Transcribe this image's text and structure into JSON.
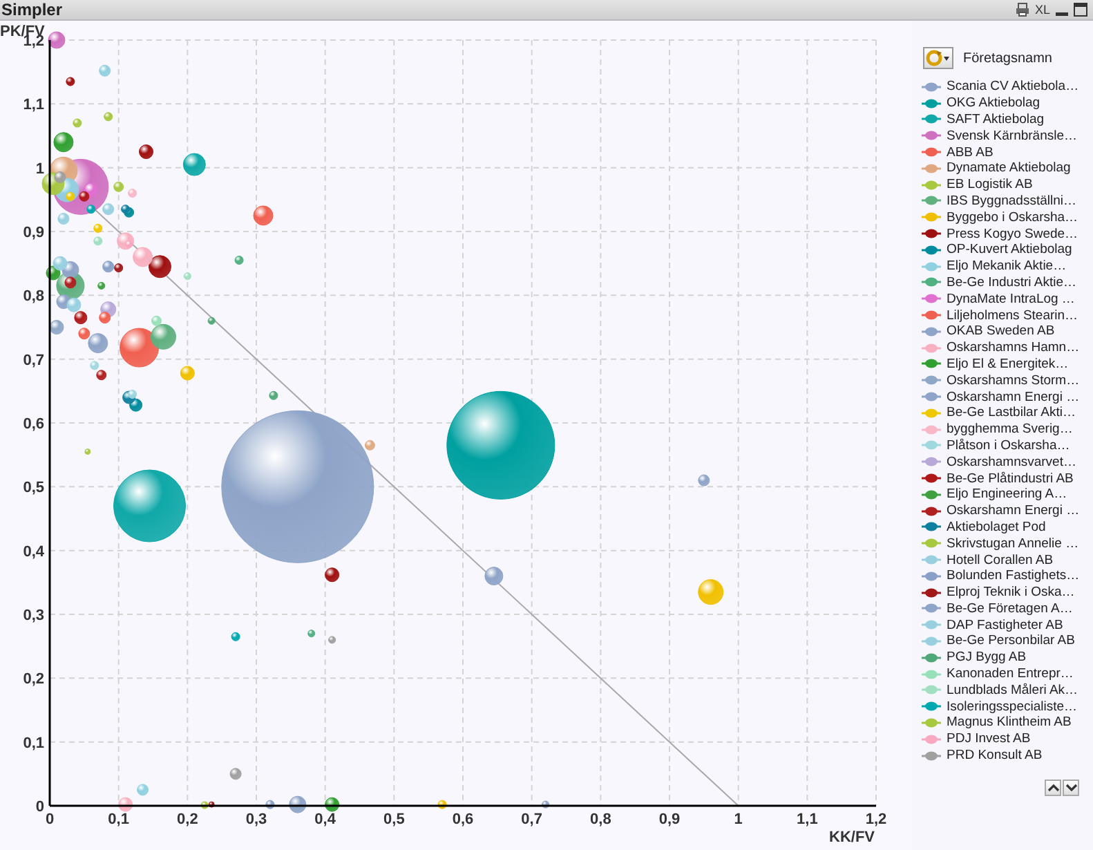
{
  "window": {
    "title": "Simpler",
    "toolbar": [
      "XL"
    ]
  },
  "chart": {
    "chart_data": {
      "type": "scatter",
      "xlabel": "KK/FV",
      "ylabel": "PK/FV",
      "xlim": [
        0,
        1.2
      ],
      "ylim": [
        0,
        1.2
      ],
      "grid": true,
      "xticks": [
        {
          "value": 0,
          "label": "0"
        },
        {
          "value": 0.1,
          "label": "0,1"
        },
        {
          "value": 0.2,
          "label": "0,2"
        },
        {
          "value": 0.3,
          "label": "0,3"
        },
        {
          "value": 0.4,
          "label": "0,4"
        },
        {
          "value": 0.5,
          "label": "0,5"
        },
        {
          "value": 0.6,
          "label": "0,6"
        },
        {
          "value": 0.7,
          "label": "0,7"
        },
        {
          "value": 0.8,
          "label": "0,8"
        },
        {
          "value": 0.9,
          "label": "0,9"
        },
        {
          "value": 1,
          "label": "1"
        },
        {
          "value": 1.1,
          "label": "1,1"
        },
        {
          "value": 1.2,
          "label": "1,2"
        }
      ],
      "yticks": [
        {
          "value": 0,
          "label": "0"
        },
        {
          "value": 0.1,
          "label": "0,1"
        },
        {
          "value": 0.2,
          "label": "0,2"
        },
        {
          "value": 0.3,
          "label": "0,3"
        },
        {
          "value": 0.4,
          "label": "0,4"
        },
        {
          "value": 0.5,
          "label": "0,5"
        },
        {
          "value": 0.6,
          "label": "0,6"
        },
        {
          "value": 0.7,
          "label": "0,7"
        },
        {
          "value": 0.8,
          "label": "0,8"
        },
        {
          "value": 0.9,
          "label": "0,9"
        },
        {
          "value": 1,
          "label": "1"
        },
        {
          "value": 1.1,
          "label": "1,1"
        },
        {
          "value": 1.2,
          "label": "1,2"
        }
      ],
      "series": [
        {
          "name": "Scania CV Aktiebola…",
          "color": "#8ea4c8",
          "x": [
            0.36,
            0.645,
            0.95,
            0.36
          ],
          "values": [
            0.5,
            0.36,
            0.51,
            0.002
          ],
          "sizes": [
            1,
            0.014,
            0.0053,
            0.0119
          ]
        },
        {
          "name": "OKG Aktiebolag",
          "color": "#00a0a0",
          "x": [
            0.655
          ],
          "values": [
            0.565
          ],
          "sizes": [
            0.503
          ]
        },
        {
          "name": "SAFT Aktiebolag",
          "color": "#10a8a8",
          "x": [
            0.145,
            0.21
          ],
          "values": [
            0.47,
            1.005
          ],
          "sizes": [
            0.2235,
            0.0212
          ]
        },
        {
          "name": "Svensk Kärnbränsle…",
          "color": "#d070c0",
          "x": [
            0.045,
            0.01
          ],
          "values": [
            0.97,
            1.2
          ],
          "sizes": [
            0.1322,
            0.0119
          ]
        },
        {
          "name": "ABB AB",
          "color": "#f06050",
          "x": [
            0.13,
            0.31
          ],
          "values": [
            0.718,
            0.925
          ],
          "sizes": [
            0.0648,
            0.0162
          ]
        },
        {
          "name": "Dynamate Aktiebolag",
          "color": "#e0a880",
          "x": [
            0.02,
            0.465
          ],
          "values": [
            0.995,
            0.565
          ],
          "sizes": [
            0.0331,
            0.004
          ]
        },
        {
          "name": "EB Logistik AB",
          "color": "#a8c840",
          "x": [
            0.005,
            0.04
          ],
          "values": [
            0.975,
            1.07
          ],
          "sizes": [
            0.0212,
            0.003
          ]
        },
        {
          "name": "IBS Byggnadsställni…",
          "color": "#60b080",
          "x": [
            0.165,
            0.03
          ],
          "values": [
            0.735,
            0.815
          ],
          "sizes": [
            0.0268,
            0.0331
          ]
        },
        {
          "name": "Byggebo i Oskarsha…",
          "color": "#f0c000",
          "x": [
            0.96,
            0.2,
            0.57
          ],
          "values": [
            0.335,
            0.678,
            0.002
          ],
          "sizes": [
            0.0268,
            0.0083,
            0.003
          ]
        },
        {
          "name": "Press Kogyo Swede…",
          "color": "#a01010",
          "x": [
            0.16,
            0.14,
            0.41,
            0.03
          ],
          "values": [
            0.845,
            1.025,
            0.362,
            1.135
          ],
          "sizes": [
            0.0212,
            0.0083,
            0.0083,
            0.003
          ]
        },
        {
          "name": "OP-Kuvert Aktiebolag",
          "color": "#008c9c",
          "x": [
            0.125,
            0.115
          ],
          "values": [
            0.628,
            0.93
          ],
          "sizes": [
            0.0067,
            0.004
          ]
        },
        {
          "name": "Eljo Mekanik Aktie…",
          "color": "#90d0e0",
          "x": [
            0.025,
            0.08,
            0.135
          ],
          "values": [
            0.965,
            1.152,
            0.025
          ],
          "sizes": [
            0.0239,
            0.0053,
            0.0053
          ]
        },
        {
          "name": "Be-Ge Industri Aktie…",
          "color": "#50b080",
          "x": [
            0.275,
            0.38
          ],
          "values": [
            0.855,
            0.27
          ],
          "sizes": [
            0.003,
            0.0021
          ]
        },
        {
          "name": "DynaMate IntraLog …",
          "color": "#e070d0",
          "x": [
            0.06
          ],
          "values": [
            0.965
          ],
          "sizes": [
            0.0083
          ]
        },
        {
          "name": "Liljeholmens Stearin…",
          "color": "#f06050",
          "x": [
            0.08,
            0.05
          ],
          "values": [
            0.765,
            0.74
          ],
          "sizes": [
            0.0053,
            0.0053
          ]
        },
        {
          "name": "OKAB Sweden AB",
          "color": "#8ea4c8",
          "x": [
            0.07,
            0.03
          ],
          "values": [
            0.725,
            0.84
          ],
          "sizes": [
            0.0162,
            0.0119
          ]
        },
        {
          "name": "Oskarshamns Hamn…",
          "color": "#f8b0c0",
          "x": [
            0.11,
            0.135,
            0.11
          ],
          "values": [
            0.885,
            0.86,
            0.002
          ],
          "sizes": [
            0.0119,
            0.0162,
            0.0083
          ]
        },
        {
          "name": "Eljo El & Energitek…",
          "color": "#30a030",
          "x": [
            0.02,
            0.005,
            0.41
          ],
          "values": [
            1.04,
            0.835,
            0.002
          ],
          "sizes": [
            0.0162,
            0.0083,
            0.0083
          ]
        },
        {
          "name": "Oskarshamns Storm…",
          "color": "#90a8c8",
          "x": [
            0.01
          ],
          "values": [
            0.75
          ],
          "sizes": [
            0.0083
          ]
        },
        {
          "name": "Oskarshamn Energi …",
          "color": "#8ea4c8",
          "x": [
            0.02
          ],
          "values": [
            0.79
          ],
          "sizes": [
            0.0083
          ]
        },
        {
          "name": "Be-Ge Lastbilar Akti…",
          "color": "#f0c800",
          "x": [
            0.07,
            0.03
          ],
          "values": [
            0.905,
            0.955
          ],
          "sizes": [
            0.003,
            0.003
          ]
        },
        {
          "name": "bygghemma Sverig…",
          "color": "#f8b8c8",
          "x": [
            0.12
          ],
          "values": [
            0.96
          ],
          "sizes": [
            0.003
          ]
        },
        {
          "name": "Plåtson i Oskarsha…",
          "color": "#a0d8e0",
          "x": [
            0.065,
            0.12
          ],
          "values": [
            0.69,
            0.645
          ],
          "sizes": [
            0.003,
            0.003
          ]
        },
        {
          "name": "Oskarshamnsvarvet…",
          "color": "#b8a8d8",
          "x": [
            0.085
          ],
          "values": [
            0.778
          ],
          "sizes": [
            0.01
          ]
        },
        {
          "name": "Be-Ge Plåtindustri AB",
          "color": "#b01818",
          "x": [
            0.045,
            0.05
          ],
          "values": [
            0.765,
            0.955
          ],
          "sizes": [
            0.0067,
            0.004
          ]
        },
        {
          "name": "Eljo Engineering A…",
          "color": "#40a040",
          "x": [
            0.075
          ],
          "values": [
            0.815
          ],
          "sizes": [
            0.0021
          ]
        },
        {
          "name": "Oskarshamn Energi …",
          "color": "#b02020",
          "x": [
            0.03,
            0.075
          ],
          "values": [
            0.82,
            0.675
          ],
          "sizes": [
            0.0053,
            0.004
          ]
        },
        {
          "name": "Aktiebolaget Pod",
          "color": "#1080a0",
          "x": [
            0.115,
            0.11
          ],
          "values": [
            0.64,
            0.935
          ],
          "sizes": [
            0.0067,
            0.003
          ]
        },
        {
          "name": "Skrivstugan Annelie …",
          "color": "#a8c840",
          "x": [
            0.085,
            0.055
          ],
          "values": [
            1.08,
            0.555
          ],
          "sizes": [
            0.003,
            0.0013
          ]
        },
        {
          "name": "Hotell Corallen AB",
          "color": "#98d0e0",
          "x": [
            0.085,
            0.035
          ],
          "values": [
            0.935,
            0.785
          ],
          "sizes": [
            0.0053,
            0.0083
          ]
        },
        {
          "name": "Bolunden Fastighets…",
          "color": "#88a0c8",
          "x": [
            0.085,
            0.32
          ],
          "values": [
            0.845,
            0.002
          ],
          "sizes": [
            0.0053,
            0.003
          ]
        },
        {
          "name": "Elproj Teknik i Oska…",
          "color": "#a01818",
          "x": [
            0.1,
            0.235
          ],
          "values": [
            0.843,
            0.002
          ],
          "sizes": [
            0.003,
            0.0013
          ]
        },
        {
          "name": "Be-Ge Företagen A…",
          "color": "#8ea4c8",
          "x": [
            0.72
          ],
          "values": [
            0.002
          ],
          "sizes": [
            0.0021
          ]
        },
        {
          "name": "DAP Fastigheter AB",
          "color": "#98d0e0",
          "x": [
            0.015
          ],
          "values": [
            0.85
          ],
          "sizes": [
            0.0083
          ]
        },
        {
          "name": "Be-Ge Personbilar AB",
          "color": "#98d0e0",
          "x": [
            0.02
          ],
          "values": [
            0.92
          ],
          "sizes": [
            0.0053
          ]
        },
        {
          "name": "PGJ Bygg AB",
          "color": "#50a878",
          "x": [
            0.325,
            0.235
          ],
          "values": [
            0.643,
            0.76
          ],
          "sizes": [
            0.003,
            0.0021
          ]
        },
        {
          "name": "Kanonaden Entrepr…",
          "color": "#98e0b8",
          "x": [
            0.155
          ],
          "values": [
            0.76
          ],
          "sizes": [
            0.004
          ]
        },
        {
          "name": "Lundblads Måleri Ak…",
          "color": "#a0e0c0",
          "x": [
            0.07,
            0.2
          ],
          "values": [
            0.885,
            0.83
          ],
          "sizes": [
            0.003,
            0.0021
          ]
        },
        {
          "name": "Isoleringsspecialiste…",
          "color": "#00a8b0",
          "x": [
            0.27,
            0.06
          ],
          "values": [
            0.265,
            0.935
          ],
          "sizes": [
            0.003,
            0.003
          ]
        },
        {
          "name": "Magnus Klintheim AB",
          "color": "#a8c840",
          "x": [
            0.1,
            0.225
          ],
          "values": [
            0.97,
            0.001
          ],
          "sizes": [
            0.004,
            0.0021
          ]
        },
        {
          "name": "PDJ Invest AB",
          "color": "#f8a8c0",
          "x": [
            0.115
          ],
          "values": [
            0.88
          ],
          "sizes": [
            0.0021
          ]
        },
        {
          "name": "PRD Konsult AB",
          "color": "#a0a0a0",
          "x": [
            0.27,
            0.41,
            0.015
          ],
          "values": [
            0.05,
            0.26,
            0.985
          ],
          "sizes": [
            0.0053,
            0.0021,
            0.0053
          ]
        },
        {
          "type": "line",
          "color": "#a8a8a8",
          "x": [
            0,
            1
          ],
          "values": [
            1,
            0
          ]
        }
      ]
    }
  },
  "legend": {
    "title": "Företagsnamn"
  }
}
